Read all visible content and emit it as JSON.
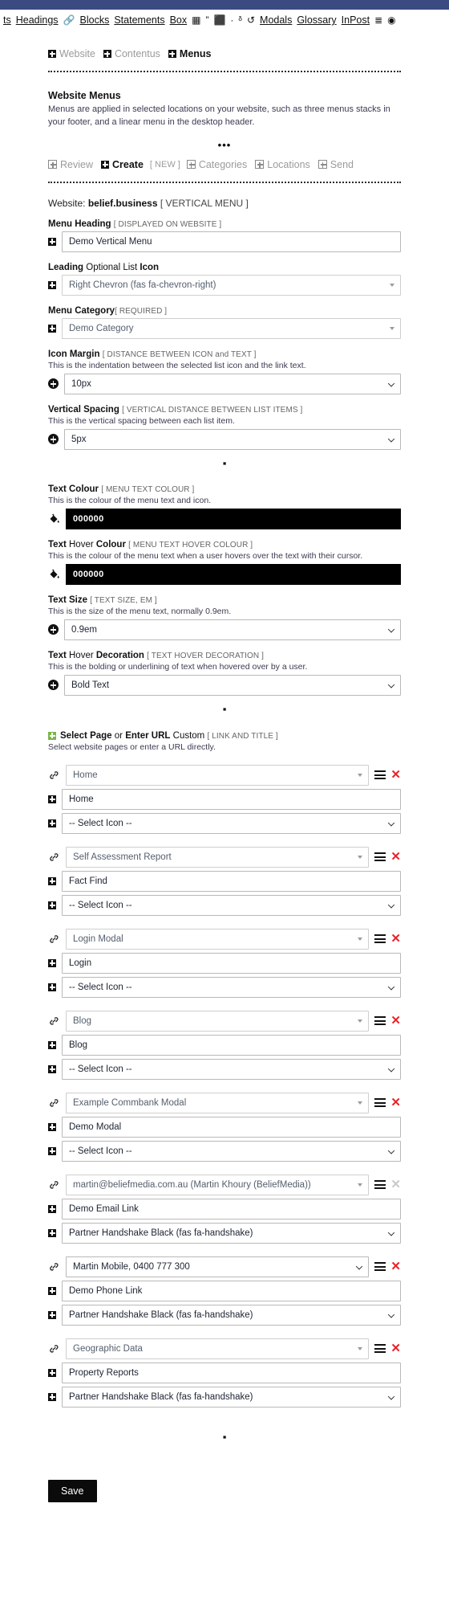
{
  "toolbar": {
    "items": [
      {
        "type": "link",
        "label": "ts"
      },
      {
        "type": "link",
        "label": "Headings"
      },
      {
        "type": "icon",
        "label": "link-icon",
        "glyph": "🔗"
      },
      {
        "type": "link",
        "label": "Blocks"
      },
      {
        "type": "link",
        "label": "Statements"
      },
      {
        "type": "link",
        "label": "Box"
      },
      {
        "type": "icon",
        "label": "table-icon",
        "glyph": "▦"
      },
      {
        "type": "icon",
        "label": "quote-icon",
        "glyph": "”"
      },
      {
        "type": "icon",
        "label": "stamp-icon",
        "glyph": "⬛"
      },
      {
        "type": "icon",
        "label": "dot-icon",
        "glyph": "·"
      },
      {
        "type": "icon",
        "label": "chart-icon",
        "glyph": "ᵟ"
      },
      {
        "type": "icon",
        "label": "undo-icon",
        "glyph": "↺"
      },
      {
        "type": "link",
        "label": "Modals"
      },
      {
        "type": "link",
        "label": "Glossary"
      },
      {
        "type": "link",
        "label": "InPost"
      },
      {
        "type": "icon",
        "label": "grid-icon",
        "glyph": "≣"
      },
      {
        "type": "icon",
        "label": "record-icon",
        "glyph": "◉"
      }
    ]
  },
  "breadcrumb_top": [
    {
      "label": "Website",
      "active": false
    },
    {
      "label": "Contentus",
      "active": false
    },
    {
      "label": "Menus",
      "active": true
    }
  ],
  "section": {
    "title": "Website Menus",
    "description": "Menus are applied in selected locations on your website, such as three menus stacks in your footer, and a linear menu in the desktop header.",
    "ellipsis": "•••"
  },
  "breadcrumb_actions": [
    {
      "label": "Review",
      "active": false,
      "tag": "",
      "icon": "hollow"
    },
    {
      "label": "Create",
      "active": true,
      "tag": "[ NEW ]",
      "icon": "solid"
    },
    {
      "label": "Categories",
      "active": false,
      "tag": "",
      "icon": "hollow"
    },
    {
      "label": "Locations",
      "active": false,
      "tag": "",
      "icon": "hollow"
    },
    {
      "label": "Send",
      "active": false,
      "tag": "",
      "icon": "hollow"
    }
  ],
  "website": {
    "prefix": "Website:",
    "name": "belief.business",
    "tag": "[ VERTICAL MENU ]"
  },
  "fields": {
    "menu_heading": {
      "label_bold": "Menu Heading",
      "label_meta": "[ DISPLAYED ON WEBSITE ]",
      "value": "Demo Vertical Menu"
    },
    "leading_icon": {
      "label_bold": "Leading",
      "label_norm": " Optional List ",
      "label_bold2": "Icon",
      "value": "Right Chevron (fas fa-chevron-right)"
    },
    "menu_category": {
      "label_bold": "Menu Category",
      "label_meta": "[ REQUIRED ]",
      "value": "Demo Category"
    },
    "icon_margin": {
      "label_bold": "Icon Margin",
      "label_meta": "[ DISTANCE BETWEEN ICON and TEXT ]",
      "help": "This is the indentation between the selected list icon and the link text.",
      "value": "10px"
    },
    "vertical_spacing": {
      "label_bold": "Vertical Spacing",
      "label_meta": "[ VERTICAL DISTANCE BETWEEN LIST ITEMS ]",
      "help": "This is the vertical spacing between each list item.",
      "value": "5px"
    },
    "text_colour": {
      "label_bold": "Text Colour",
      "label_meta": "[ MENU TEXT COLOUR ]",
      "help": "This is the colour of the menu text and icon.",
      "value": "000000",
      "swatch": "#000000"
    },
    "text_hover_colour": {
      "label_bold": "Text",
      "label_norm": " Hover ",
      "label_bold2": "Colour",
      "label_meta": "[ MENU TEXT HOVER COLOUR ]",
      "help": "This is the colour of the menu text when a user hovers over the text with their cursor.",
      "value": "000000",
      "swatch": "#000000"
    },
    "text_size": {
      "label_bold": "Text Size",
      "label_meta": "[ TEXT SIZE, EM ]",
      "help": "This is the size of the menu text, normally 0.9em.",
      "value": "0.9em"
    },
    "text_hover_decoration": {
      "label_bold": "Text",
      "label_norm": " Hover ",
      "label_bold2": "Decoration",
      "label_meta": "[ TEXT HOVER DECORATION ]",
      "help": "This is the bolding or underlining of text when hovered over by a user.",
      "value": "Bold Text"
    }
  },
  "links_section": {
    "label_bold1": "Select Page",
    "label_norm1": " or ",
    "label_bold2": "Enter URL",
    "label_norm2": " Custom ",
    "label_meta": "[ LINK AND TITLE ]",
    "help": "Select website pages or enter a URL directly."
  },
  "links": [
    {
      "page": "Home",
      "title": "Home",
      "icon": "-- Select Icon --",
      "page_style": "light",
      "delete_enabled": true
    },
    {
      "page": "Self Assessment Report",
      "title": "Fact Find",
      "icon": "-- Select Icon --",
      "page_style": "light",
      "delete_enabled": true
    },
    {
      "page": "Login Modal",
      "title": "Login",
      "icon": "-- Select Icon --",
      "page_style": "light",
      "delete_enabled": true
    },
    {
      "page": "Blog",
      "title": "Blog",
      "icon": "-- Select Icon --",
      "page_style": "light",
      "delete_enabled": true
    },
    {
      "page": "Example Commbank Modal",
      "title": "Demo Modal",
      "icon": "-- Select Icon --",
      "page_style": "light",
      "delete_enabled": true
    },
    {
      "page": "martin@beliefmedia.com.au (Martin Khoury (BeliefMedia))",
      "title": "Demo Email Link",
      "icon": "Partner Handshake Black (fas fa-handshake)",
      "page_style": "light",
      "delete_enabled": false
    },
    {
      "page": "Martin Mobile, 0400 777 300",
      "title": "Demo Phone Link",
      "icon": "Partner Handshake Black (fas fa-handshake)",
      "page_style": "dark",
      "delete_enabled": true
    },
    {
      "page": "Geographic Data",
      "title": "Property Reports",
      "icon": "Partner Handshake Black (fas fa-handshake)",
      "page_style": "light",
      "delete_enabled": true
    }
  ],
  "footer": {
    "tiny_dot": "▪",
    "save_label": "Save"
  }
}
